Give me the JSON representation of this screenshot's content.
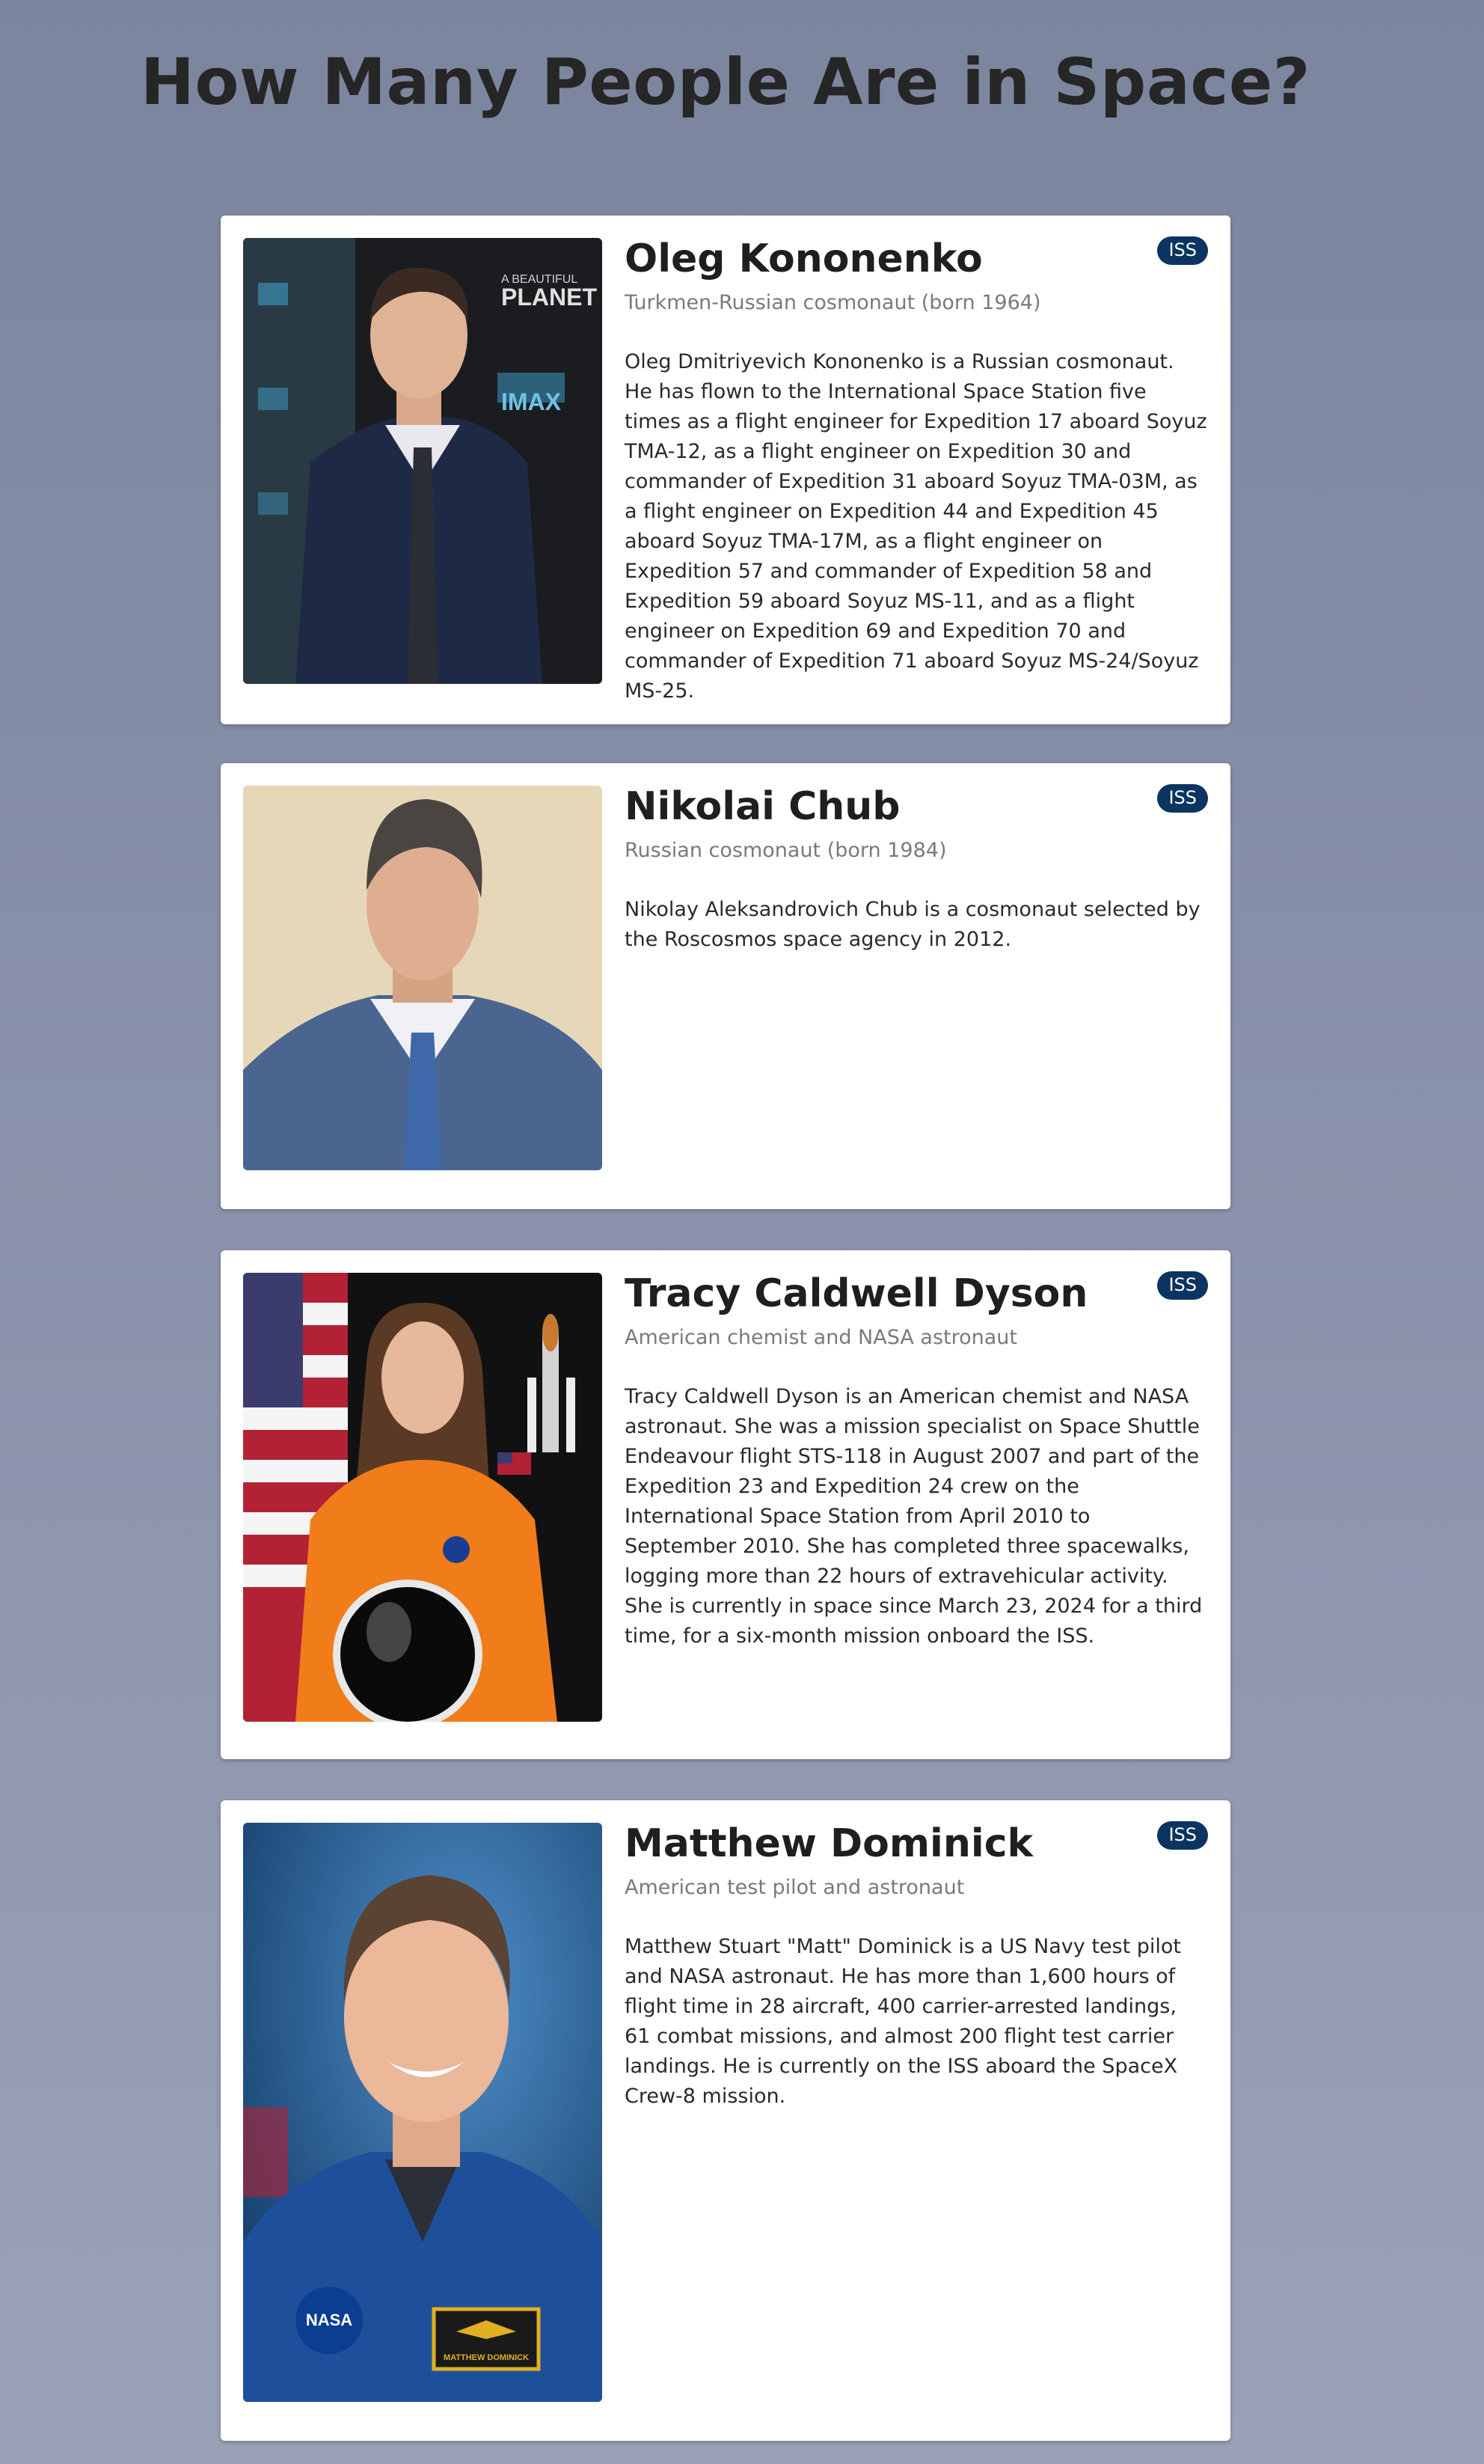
{
  "page": {
    "title": "How Many People Are in Space?"
  },
  "astronauts": [
    {
      "name": "Oleg Kononenko",
      "subtitle": "Turkmen-Russian cosmonaut (born 1964)",
      "badge": "ISS",
      "photo_alt": "Oleg Kononenko",
      "bio": "Oleg Dmitriyevich Kononenko is a Russian cosmonaut. He has flown to the International Space Station five times as a flight engineer for Expedition 17 aboard Soyuz TMA-12, as a flight engineer on Expedition 30 and commander of Expedition 31 aboard Soyuz TMA-03M, as a flight engineer on Expedition 44 and Expedition 45 aboard Soyuz TMA-17M, as a flight engineer on Expedition 57 and commander of Expedition 58 and Expedition 59 aboard Soyuz MS-11, and as a flight engineer on Expedition 69 and Expedition 70 and commander of Expedition 71 aboard Soyuz MS-24/Soyuz MS-25.",
      "photo_text": [
        "A BEAUTIFUL",
        "PLANET",
        "IMAX"
      ]
    },
    {
      "name": "Nikolai Chub",
      "subtitle": "Russian cosmonaut (born 1984)",
      "badge": "ISS",
      "photo_alt": "Nikolai Chub",
      "bio": "Nikolay Aleksandrovich Chub is a cosmonaut selected by the Roscosmos space agency in 2012."
    },
    {
      "name": "Tracy Caldwell Dyson",
      "subtitle": "American chemist and NASA astronaut",
      "badge": "ISS",
      "photo_alt": "Tracy Caldwell Dyson",
      "bio": "Tracy Caldwell Dyson is an American chemist and NASA astronaut. She was a mission specialist on Space Shuttle Endeavour flight STS-118 in August 2007 and part of the Expedition 23 and Expedition 24 crew on the International Space Station from April 2010 to September 2010. She has completed three spacewalks, logging more than 22 hours of extravehicular activity. She is currently in space since March 23, 2024 for a third time, for a six-month mission onboard the ISS."
    },
    {
      "name": "Matthew Dominick",
      "subtitle": "American test pilot and astronaut",
      "badge": "ISS",
      "photo_alt": "Matthew Dominick",
      "bio": "Matthew Stuart \"Matt\" Dominick is a US Navy test pilot and NASA astronaut. He has more than 1,600 hours of flight time in 28 aircraft, 400 carrier-arrested landings, 61 combat missions, and almost 200 flight test carrier landings. He is currently on the ISS aboard the SpaceX Crew-8 mission.",
      "photo_text": [
        "NASA",
        "MATTHEW DOMINICK"
      ]
    }
  ],
  "colors": {
    "badge_bg": "#0c3460",
    "card_bg": "#ffffff",
    "title": "#262626",
    "subtitle": "#7a7a7a"
  }
}
